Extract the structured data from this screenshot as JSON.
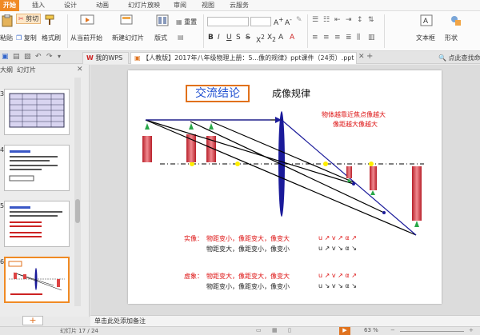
{
  "menubar": {
    "tabs": [
      "开始",
      "插入",
      "设计",
      "动画",
      "幻灯片放映",
      "审阅",
      "视图",
      "云服务"
    ]
  },
  "ribbon": {
    "cut": "剪切",
    "paste": "粘贴",
    "copy": "复制",
    "format_painter": "格式刷",
    "from_current": "从当前开始",
    "new_slide": "新建幻灯片",
    "layout": "版式",
    "reset": "重置",
    "textbox": "文本框",
    "shape": "形状"
  },
  "tabbar": {
    "wps_tab": "我的WPS",
    "doc_tab": "【人教版】2017年八年级物理上册：5...像的规律》ppt课件（24页）.ppt",
    "search_hint": "点此查找命"
  },
  "leftpanel": {
    "tab_outline": "大纲",
    "tab_slides": "幻灯片",
    "slide_numbers": [
      "3",
      "4",
      "5",
      "6"
    ]
  },
  "slide": {
    "title": "交流结论",
    "heading": "成像规律",
    "note_line1": "物体越靠近焦点像越大",
    "note_line2": "像距越大像越大",
    "real_label": "实像：",
    "real_line1": "物距变小，像距变大，像变大",
    "real_line2": "物距变大，像距变小，像变小",
    "real_sym1": "u ↗ v ↗ α ↗",
    "real_sym2": "u ↗ v ↘ α ↘",
    "virtual_label": "虚象：",
    "virtual_line1": "物距变大，像距变大，像变大",
    "virtual_line2": "物距变小，像距变小，像变小",
    "virtual_sym1": "u ↗ v ↗ α ↗",
    "virtual_sym2": "u ↘ v ↘ α ↘"
  },
  "notes": {
    "placeholder": "单击此处添加备注"
  },
  "status": {
    "slide_info": "幻灯片 17 / 24",
    "zoom": "63 %"
  },
  "colors": {
    "accent": "#f08a24",
    "title_border": "#e1711b",
    "title_text": "#1f4fd0",
    "red_text": "#dd1111",
    "lens_blue": "#1a1a9a"
  }
}
